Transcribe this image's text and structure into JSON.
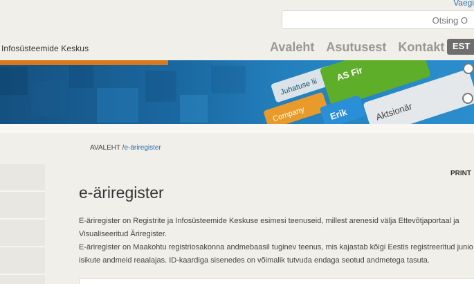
{
  "header": {
    "top_link": "Vaegi",
    "search_placeholder": "Otsing",
    "search_icon_glyph": "O",
    "org_name": "Infosüsteemide Keskus"
  },
  "nav": {
    "items": [
      "Avaleht",
      "Asutusest",
      "Kontakt"
    ],
    "language": "EST"
  },
  "banner": {
    "labels": [
      "AS Fir",
      "Juhatuse lii",
      "Company",
      "Erik",
      "Aktsionär"
    ]
  },
  "breadcrumb": {
    "home": "AVALEHT",
    "separator": " /",
    "current": "e-äriregister"
  },
  "page": {
    "print_label": "PRINT",
    "title": "e-äriregister",
    "paragraph_lines": [
      "E-äriregister on Registrite ja Infosüsteemide Keskuse esimesi teenuseid, millest arenesid välja Ettevõtjaportaal ja",
      "Visualiseeritud Äriregister.",
      "E-äriregister on Maakohtu registriosakonna andmebaasil tuginev teenus, mis kajastab kõigi Eestis registreeritud junio",
      "isikute andmeid reaalajas. ID-kaardiga sisenedes on võimalik tutvuda endaga seotud andmetega tasuta."
    ]
  },
  "colors": {
    "background": "#f1efe9",
    "accent_orange": "#d87a1b",
    "link_blue": "#2a6fb0",
    "nav_gray": "#9a9893",
    "green_card": "#5fae2a"
  }
}
